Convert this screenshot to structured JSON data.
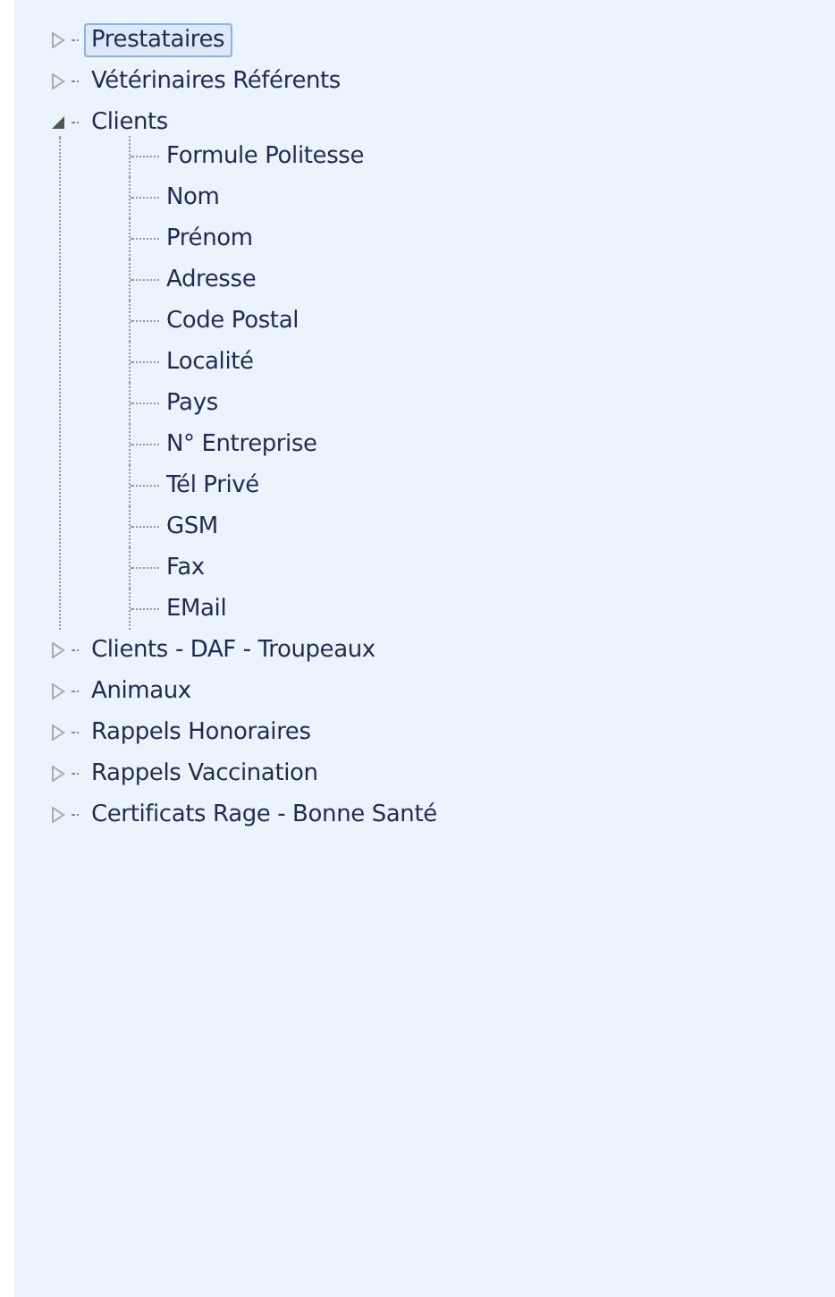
{
  "tree": [
    {
      "label": "Prestataires",
      "expanded": false,
      "selected": true
    },
    {
      "label": "Vétérinaires Référents",
      "expanded": false,
      "selected": false
    },
    {
      "label": "Clients",
      "expanded": true,
      "selected": false,
      "children": [
        {
          "label": "Formule Politesse",
          "selected": false
        },
        {
          "label": "Nom",
          "selected": false
        },
        {
          "label": "Prénom",
          "selected": false
        },
        {
          "label": "Adresse",
          "selected": false
        },
        {
          "label": "Code Postal",
          "selected": false
        },
        {
          "label": "Localité",
          "selected": false
        },
        {
          "label": "Pays",
          "selected": false
        },
        {
          "label": "N° Entreprise",
          "selected": false
        },
        {
          "label": "Tél Privé",
          "selected": false
        },
        {
          "label": "GSM",
          "selected": false
        },
        {
          "label": "Fax",
          "selected": false
        },
        {
          "label": "EMail",
          "selected": false
        }
      ]
    },
    {
      "label": "Clients - DAF - Troupeaux",
      "expanded": false,
      "selected": false
    },
    {
      "label": "Animaux",
      "expanded": false,
      "selected": false
    },
    {
      "label": "Rappels Honoraires",
      "expanded": false,
      "selected": false
    },
    {
      "label": "Rappels Vaccination",
      "expanded": false,
      "selected": false
    },
    {
      "label": "Certificats Rage - Bonne Santé",
      "expanded": false,
      "selected": false
    }
  ]
}
